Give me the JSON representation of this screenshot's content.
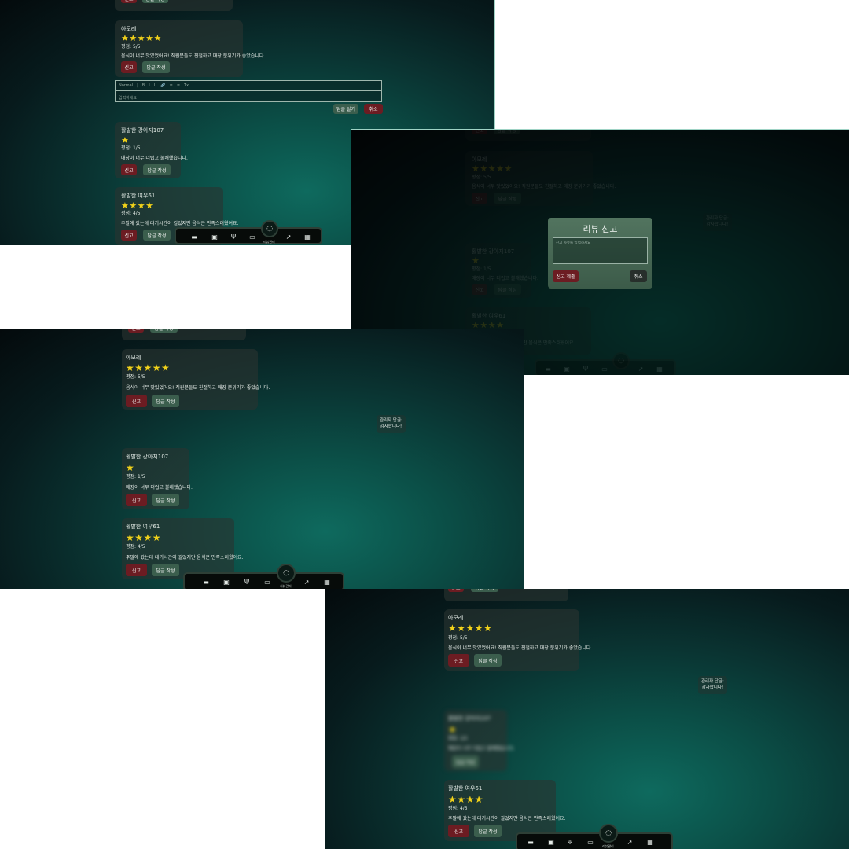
{
  "reviews": {
    "review1": {
      "nickname": "아모레",
      "stars": "★★★★★",
      "rating": "평점: 5/5",
      "text": "음식이 너무 맛있었어요! 직원분들도 친절하고 매장 분위기가 좋았습니다."
    },
    "review2": {
      "nickname": "활발한 강아지107",
      "stars": "★",
      "rating": "평점: 1/5",
      "text": "매장이 너무 더럽고 불쾌했습니다."
    },
    "review3": {
      "nickname": "활발한 여우61",
      "stars": "★★★★",
      "rating": "평점: 4/5",
      "text": "주말에 갔는데 대기시간이 길었지만 음식은 만족스러웠어요."
    }
  },
  "buttons": {
    "report": "신고",
    "reply": "답글 작성",
    "submit_reply": "답글 달기",
    "cancel": "취소"
  },
  "editor": {
    "format": "Normal",
    "toolbar_glyphs": [
      "B",
      "I",
      "U",
      "🔗",
      "≡",
      "≡",
      "Tx"
    ],
    "placeholder": "입력하세요"
  },
  "reply_box": {
    "label": "관리자 답글:",
    "text": "감사합니다!"
  },
  "report_modal": {
    "title": "리뷰 신고",
    "placeholder": "신고 사유를 입력하세요",
    "submit": "신고 제출",
    "cancel": "취소"
  },
  "nav": {
    "items": [
      "store-icon",
      "id-card-icon",
      "utensils-icon",
      "menu-board-icon",
      "chat-icon",
      "chart-icon",
      "calendar-icon"
    ],
    "active_label": "리뷰관리"
  }
}
